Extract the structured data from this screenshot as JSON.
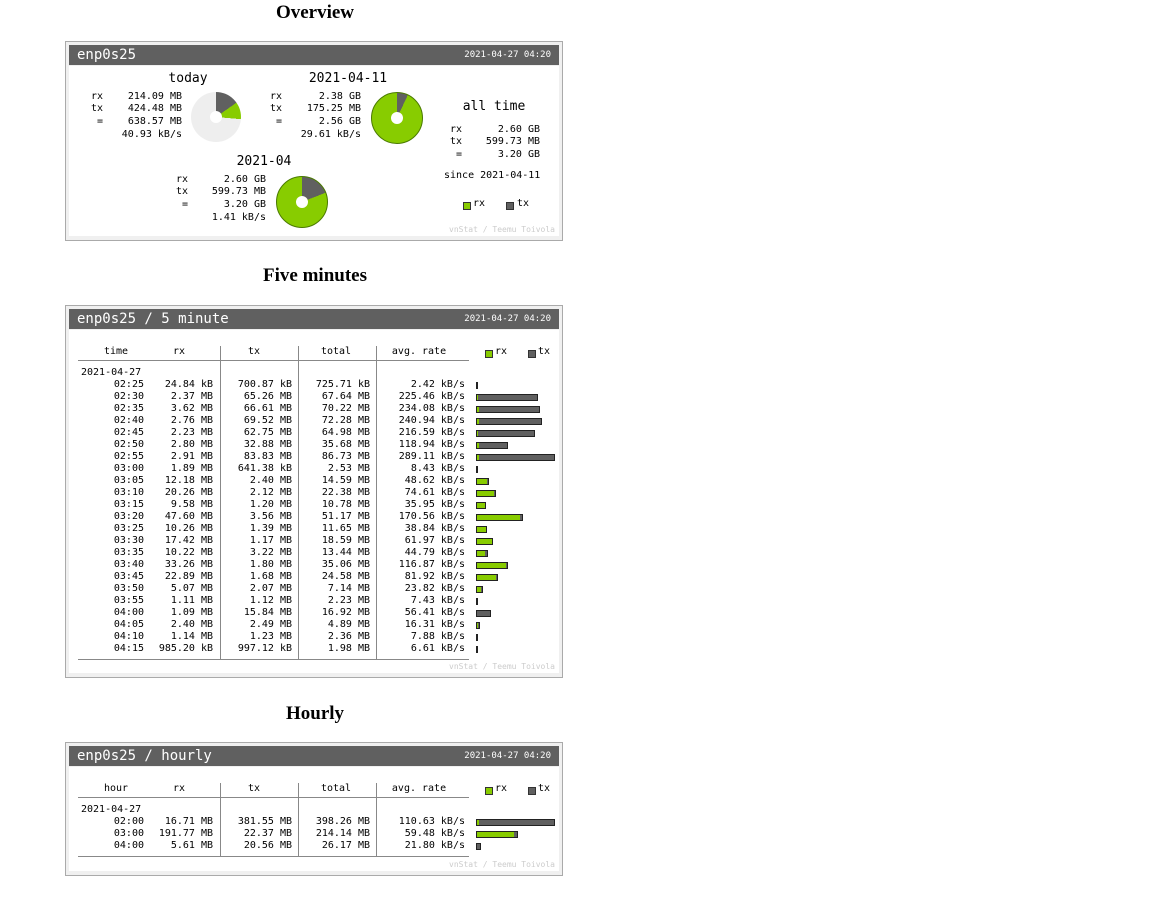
{
  "titles": {
    "overview": "Overview",
    "five": "Five minutes",
    "hourly": "Hourly"
  },
  "colors": {
    "rx": "#88cc00",
    "tx": "#606060"
  },
  "overview": {
    "iface": "enp0s25",
    "timestamp": "2021-04-27 04:20",
    "today": {
      "label": "today",
      "rx": "214.09 MB",
      "tx": "424.48 MB",
      "total": "638.57 MB",
      "rate": "40.93 kB/s",
      "rx_share": 0.34
    },
    "yesterday": {
      "label": "2021-04-11",
      "rx": "2.38 GB",
      "tx": "175.25 MB",
      "total": "2.56 GB",
      "rate": "29.61 kB/s",
      "rx_share": 0.93
    },
    "month": {
      "label": "2021-04",
      "rx": "2.60 GB",
      "tx": "599.73 MB",
      "total": "3.20 GB",
      "rate": "1.41 kB/s",
      "rx_share": 0.81
    },
    "alltime": {
      "label": "all time",
      "rx": "2.60 GB",
      "tx": "599.73 MB",
      "total": "3.20 GB",
      "since": "since 2021-04-11"
    },
    "labels": {
      "rx": "rx",
      "tx": "tx",
      "eq": "="
    },
    "legend": {
      "rx": "rx",
      "tx": "tx"
    },
    "credit": "vnStat / Teemu Toivola"
  },
  "five": {
    "title": "enp0s25 / 5 minute",
    "timestamp": "2021-04-27 04:20",
    "headers": {
      "time": "time",
      "rx": "rx",
      "tx": "tx",
      "total": "total",
      "rate": "avg. rate"
    },
    "legend": {
      "rx": "rx",
      "tx": "tx"
    },
    "date": "2021-04-27",
    "rows": [
      {
        "time": "02:25",
        "rx": "24.84 kB",
        "tx": "700.87 kB",
        "total": "725.71 kB",
        "rate": "2.42 kB/s",
        "rxv": 0.03,
        "txv": 0.8
      },
      {
        "time": "02:30",
        "rx": "2.37 MB",
        "tx": "65.26 MB",
        "total": "67.64 MB",
        "rate": "225.46 kB/s",
        "rxv": 2.37,
        "txv": 65.26
      },
      {
        "time": "02:35",
        "rx": "3.62 MB",
        "tx": "66.61 MB",
        "total": "70.22 MB",
        "rate": "234.08 kB/s",
        "rxv": 3.62,
        "txv": 66.61
      },
      {
        "time": "02:40",
        "rx": "2.76 MB",
        "tx": "69.52 MB",
        "total": "72.28 MB",
        "rate": "240.94 kB/s",
        "rxv": 2.76,
        "txv": 69.52
      },
      {
        "time": "02:45",
        "rx": "2.23 MB",
        "tx": "62.75 MB",
        "total": "64.98 MB",
        "rate": "216.59 kB/s",
        "rxv": 2.23,
        "txv": 62.75
      },
      {
        "time": "02:50",
        "rx": "2.80 MB",
        "tx": "32.88 MB",
        "total": "35.68 MB",
        "rate": "118.94 kB/s",
        "rxv": 2.8,
        "txv": 32.88
      },
      {
        "time": "02:55",
        "rx": "2.91 MB",
        "tx": "83.83 MB",
        "total": "86.73 MB",
        "rate": "289.11 kB/s",
        "rxv": 2.91,
        "txv": 83.83
      },
      {
        "time": "03:00",
        "rx": "1.89 MB",
        "tx": "641.38 kB",
        "total": "2.53 MB",
        "rate": "8.43 kB/s",
        "rxv": 1.89,
        "txv": 0.64
      },
      {
        "time": "03:05",
        "rx": "12.18 MB",
        "tx": "2.40 MB",
        "total": "14.59 MB",
        "rate": "48.62 kB/s",
        "rxv": 12.18,
        "txv": 2.4
      },
      {
        "time": "03:10",
        "rx": "20.26 MB",
        "tx": "2.12 MB",
        "total": "22.38 MB",
        "rate": "74.61 kB/s",
        "rxv": 20.26,
        "txv": 2.12
      },
      {
        "time": "03:15",
        "rx": "9.58 MB",
        "tx": "1.20 MB",
        "total": "10.78 MB",
        "rate": "35.95 kB/s",
        "rxv": 9.58,
        "txv": 1.2
      },
      {
        "time": "03:20",
        "rx": "47.60 MB",
        "tx": "3.56 MB",
        "total": "51.17 MB",
        "rate": "170.56 kB/s",
        "rxv": 47.6,
        "txv": 3.56
      },
      {
        "time": "03:25",
        "rx": "10.26 MB",
        "tx": "1.39 MB",
        "total": "11.65 MB",
        "rate": "38.84 kB/s",
        "rxv": 10.26,
        "txv": 1.39
      },
      {
        "time": "03:30",
        "rx": "17.42 MB",
        "tx": "1.17 MB",
        "total": "18.59 MB",
        "rate": "61.97 kB/s",
        "rxv": 17.42,
        "txv": 1.17
      },
      {
        "time": "03:35",
        "rx": "10.22 MB",
        "tx": "3.22 MB",
        "total": "13.44 MB",
        "rate": "44.79 kB/s",
        "rxv": 10.22,
        "txv": 3.22
      },
      {
        "time": "03:40",
        "rx": "33.26 MB",
        "tx": "1.80 MB",
        "total": "35.06 MB",
        "rate": "116.87 kB/s",
        "rxv": 33.26,
        "txv": 1.8
      },
      {
        "time": "03:45",
        "rx": "22.89 MB",
        "tx": "1.68 MB",
        "total": "24.58 MB",
        "rate": "81.92 kB/s",
        "rxv": 22.89,
        "txv": 1.68
      },
      {
        "time": "03:50",
        "rx": "5.07 MB",
        "tx": "2.07 MB",
        "total": "7.14 MB",
        "rate": "23.82 kB/s",
        "rxv": 5.07,
        "txv": 2.07
      },
      {
        "time": "03:55",
        "rx": "1.11 MB",
        "tx": "1.12 MB",
        "total": "2.23 MB",
        "rate": "7.43 kB/s",
        "rxv": 1.11,
        "txv": 1.12
      },
      {
        "time": "04:00",
        "rx": "1.09 MB",
        "tx": "15.84 MB",
        "total": "16.92 MB",
        "rate": "56.41 kB/s",
        "rxv": 1.09,
        "txv": 15.84
      },
      {
        "time": "04:05",
        "rx": "2.40 MB",
        "tx": "2.49 MB",
        "total": "4.89 MB",
        "rate": "16.31 kB/s",
        "rxv": 2.4,
        "txv": 2.49
      },
      {
        "time": "04:10",
        "rx": "1.14 MB",
        "tx": "1.23 MB",
        "total": "2.36 MB",
        "rate": "7.88 kB/s",
        "rxv": 1.14,
        "txv": 1.23
      },
      {
        "time": "04:15",
        "rx": "985.20 kB",
        "tx": "997.12 kB",
        "total": "1.98 MB",
        "rate": "6.61 kB/s",
        "rxv": 0.99,
        "txv": 1.0
      }
    ],
    "credit": "vnStat / Teemu Toivola"
  },
  "hourly": {
    "title": "enp0s25 / hourly",
    "timestamp": "2021-04-27 04:20",
    "headers": {
      "hour": "hour",
      "rx": "rx",
      "tx": "tx",
      "total": "total",
      "rate": "avg. rate"
    },
    "legend": {
      "rx": "rx",
      "tx": "tx"
    },
    "date": "2021-04-27",
    "rows": [
      {
        "time": "02:00",
        "rx": "16.71 MB",
        "tx": "381.55 MB",
        "total": "398.26 MB",
        "rate": "110.63 kB/s",
        "rxv": 16.71,
        "txv": 381.55
      },
      {
        "time": "03:00",
        "rx": "191.77 MB",
        "tx": "22.37 MB",
        "total": "214.14 MB",
        "rate": "59.48 kB/s",
        "rxv": 191.77,
        "txv": 22.37
      },
      {
        "time": "04:00",
        "rx": "5.61 MB",
        "tx": "20.56 MB",
        "total": "26.17 MB",
        "rate": "21.80 kB/s",
        "rxv": 5.61,
        "txv": 20.56
      }
    ],
    "credit": "vnStat / Teemu Toivola"
  }
}
